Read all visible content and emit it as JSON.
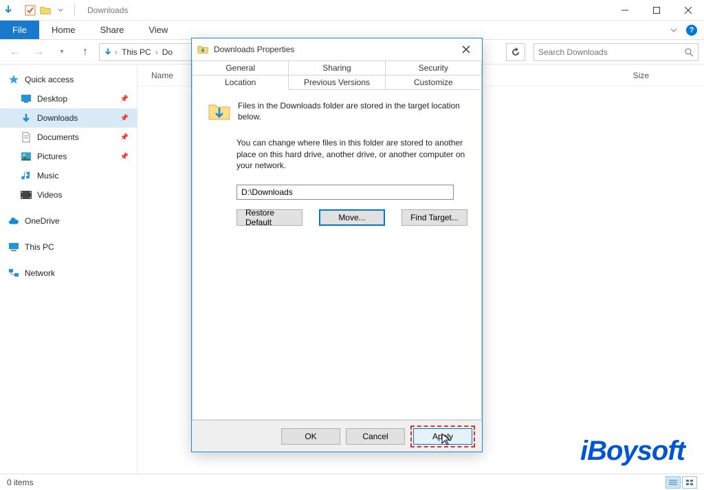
{
  "window": {
    "title": "Downloads"
  },
  "ribbon": {
    "file": "File",
    "tabs": [
      "Home",
      "Share",
      "View"
    ]
  },
  "breadcrumb": {
    "root": "This PC",
    "current_trunc": "Do"
  },
  "search": {
    "placeholder": "Search Downloads"
  },
  "sidebar": {
    "quick_access": "Quick access",
    "items": [
      {
        "label": "Desktop"
      },
      {
        "label": "Downloads"
      },
      {
        "label": "Documents"
      },
      {
        "label": "Pictures"
      },
      {
        "label": "Music"
      },
      {
        "label": "Videos"
      }
    ],
    "onedrive": "OneDrive",
    "thispc": "This PC",
    "network": "Network"
  },
  "columns": {
    "name": "Name",
    "size": "Size"
  },
  "status": {
    "items": "0 items"
  },
  "dialog": {
    "title": "Downloads Properties",
    "tabs_row1": [
      "General",
      "Sharing",
      "Security"
    ],
    "tabs_row2": [
      "Location",
      "Previous Versions",
      "Customize"
    ],
    "intro": "Files in the Downloads folder are stored in the target location below.",
    "para": "You can change where files in this folder are stored to another place on this hard drive, another drive, or another computer on your network.",
    "path": "D:\\Downloads",
    "btn_restore": "Restore Default",
    "btn_move": "Move...",
    "btn_find": "Find Target...",
    "btn_ok": "OK",
    "btn_cancel": "Cancel",
    "btn_apply": "Apply"
  },
  "watermark": "iBoysoft"
}
